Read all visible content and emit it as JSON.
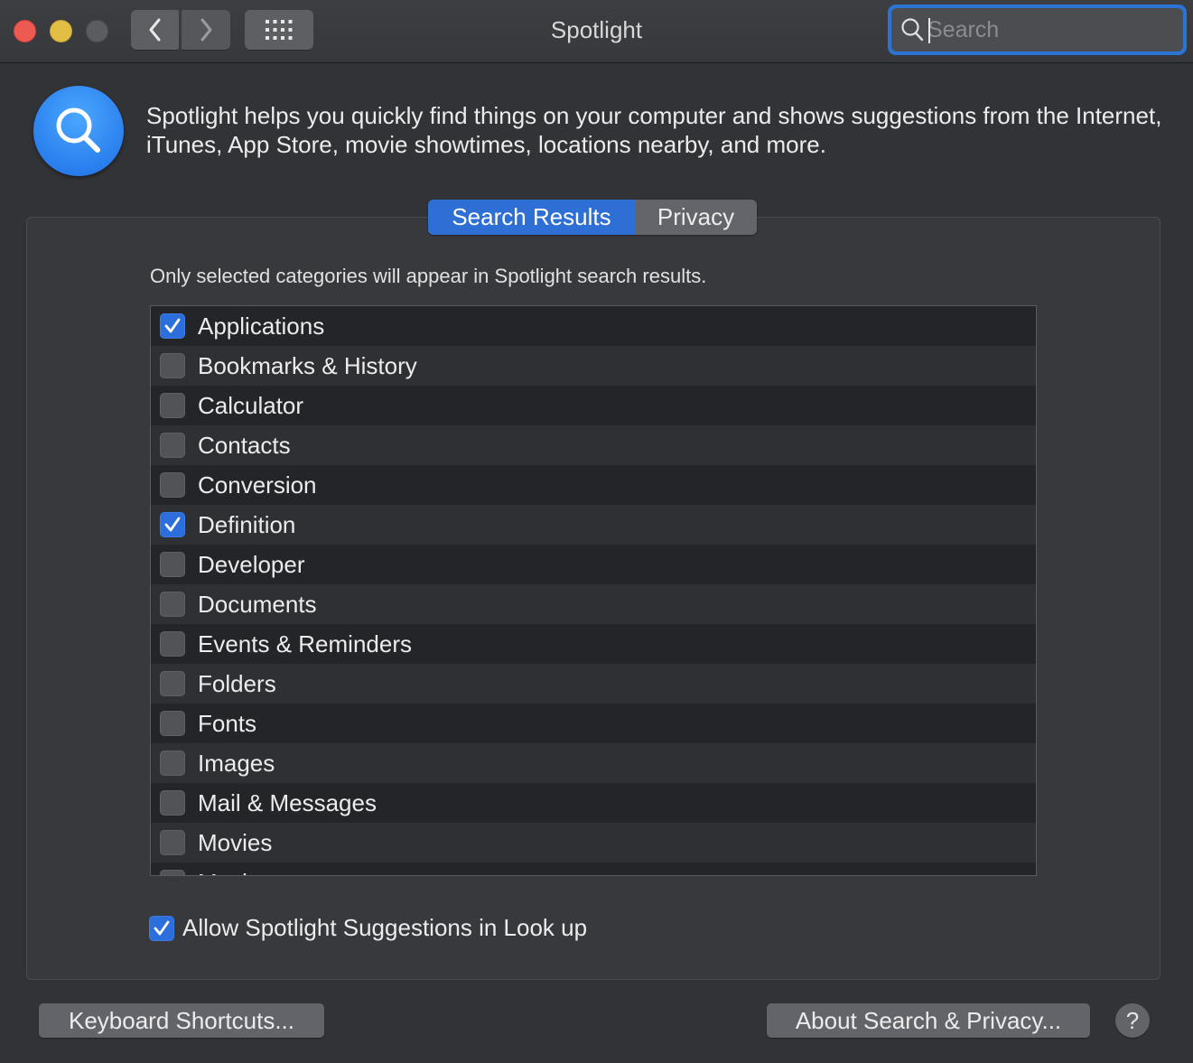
{
  "window": {
    "title": "Spotlight"
  },
  "toolbar": {
    "back_icon": "chevron-left",
    "forward_icon": "chevron-right",
    "grid_icon": "grid-dots",
    "search": {
      "placeholder": "Search",
      "value": ""
    }
  },
  "header": {
    "icon": "spotlight-magnifier",
    "description": "Spotlight helps you quickly find things on your computer and shows suggestions from the Internet, iTunes, App Store, movie showtimes, locations nearby, and more."
  },
  "tabs": [
    {
      "label": "Search Results",
      "active": true
    },
    {
      "label": "Privacy",
      "active": false
    }
  ],
  "search_results": {
    "hint": "Only selected categories will appear in Spotlight search results.",
    "categories": [
      {
        "label": "Applications",
        "checked": true
      },
      {
        "label": "Bookmarks & History",
        "checked": false
      },
      {
        "label": "Calculator",
        "checked": false
      },
      {
        "label": "Contacts",
        "checked": false
      },
      {
        "label": "Conversion",
        "checked": false
      },
      {
        "label": "Definition",
        "checked": true
      },
      {
        "label": "Developer",
        "checked": false
      },
      {
        "label": "Documents",
        "checked": false
      },
      {
        "label": "Events & Reminders",
        "checked": false
      },
      {
        "label": "Folders",
        "checked": false
      },
      {
        "label": "Fonts",
        "checked": false
      },
      {
        "label": "Images",
        "checked": false
      },
      {
        "label": "Mail & Messages",
        "checked": false
      },
      {
        "label": "Movies",
        "checked": false
      },
      {
        "label": "Music",
        "checked": false
      }
    ],
    "allow_suggestions": {
      "label": "Allow Spotlight Suggestions in Look up",
      "checked": true
    }
  },
  "footer": {
    "keyboard_shortcuts_label": "Keyboard Shortcuts...",
    "about_label": "About Search & Privacy...",
    "help_label": "?"
  },
  "colors": {
    "accent": "#2e6fd6",
    "background": "#323337",
    "close": "#ee5a52",
    "minimize": "#e3be45"
  }
}
